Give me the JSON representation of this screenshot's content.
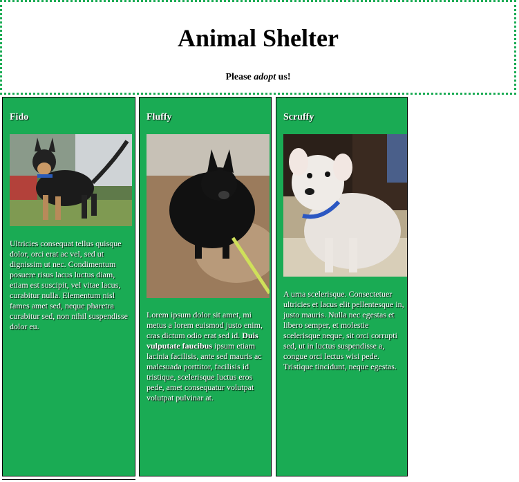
{
  "header": {
    "title": "Animal Shelter",
    "tagline_pre": "Please ",
    "tagline_em": "adopt",
    "tagline_post": " us!"
  },
  "pets": [
    {
      "name": "Fido",
      "photo_alt": "Fido photo",
      "description": "Ultricies consequat tellus quisque dolor, orci erat ac vel, sed ut dignissim ut nec. Condimentum posuere risus lacus luctus diam, etiam est suscipit, vel vitae lacus, curabitur nulla. Elementum nisl fames amet sed, neque pharetra curabitur sed, non nihil suspendisse dolor eu."
    },
    {
      "name": "Fluffy",
      "photo_alt": "Fluffy photo",
      "description_pre": "Lorem ipsum dolor sit amet, mi metus a lorem euismod justo enim, cras dictum odio erat sed id. ",
      "description_bold": "Duis vulputate faucibus",
      "description_post": " ipsum etiam lacinia facilisis, ante sed mauris ac malesuada porttitor, facilisis id tristique, scelerisque luctus eros pede, amet consequatur volutpat volutpat pulvinar at."
    },
    {
      "name": "Scruffy",
      "photo_alt": "Scruffy photo",
      "description": "A urna scelerisque. Consectetuer ultricies et lacus elit pellentesque in, justo mauris. Nulla nec egestas et libero semper, et molestie scelerisque neque, sit orci corrupti sed, ut in luctus suspendisse a, congue orci lectus wisi pede. Tristique tincidunt, neque egestas."
    }
  ],
  "colors": {
    "accent_green": "#1aab54",
    "text_white": "#ffffff"
  }
}
